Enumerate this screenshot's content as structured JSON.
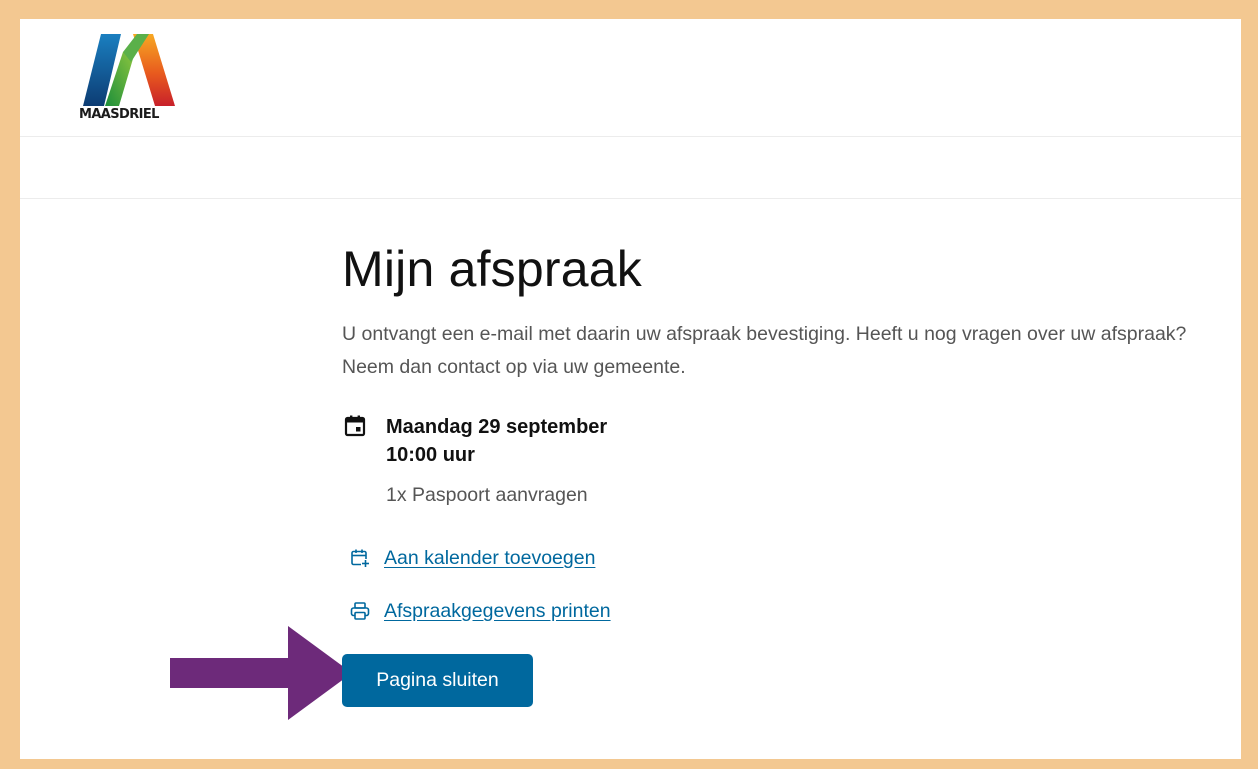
{
  "logo": {
    "text": "MAASDRIEL"
  },
  "page": {
    "title": "Mijn afspraak",
    "intro": "U ontvangt een e-mail met daarin uw afspraak bevestiging. Heeft u nog vragen over uw afspraak? Neem dan contact op via uw gemeente."
  },
  "appointment": {
    "date": "Maandag 29 september",
    "time": "10:00 uur",
    "service": "1x Paspoort aanvragen"
  },
  "actions": {
    "add_calendar_label": "Aan kalender toevoegen",
    "print_label": "Afspraakgegevens printen",
    "close_label": "Pagina sluiten"
  },
  "icons": {
    "calendar": "calendar-icon",
    "calendar_add": "calendar-add-icon",
    "print": "printer-icon",
    "arrow": "arrow-right-icon"
  },
  "colors": {
    "frame": "#f3c891",
    "primary": "#00689e",
    "arrow": "#6d2a7a"
  }
}
